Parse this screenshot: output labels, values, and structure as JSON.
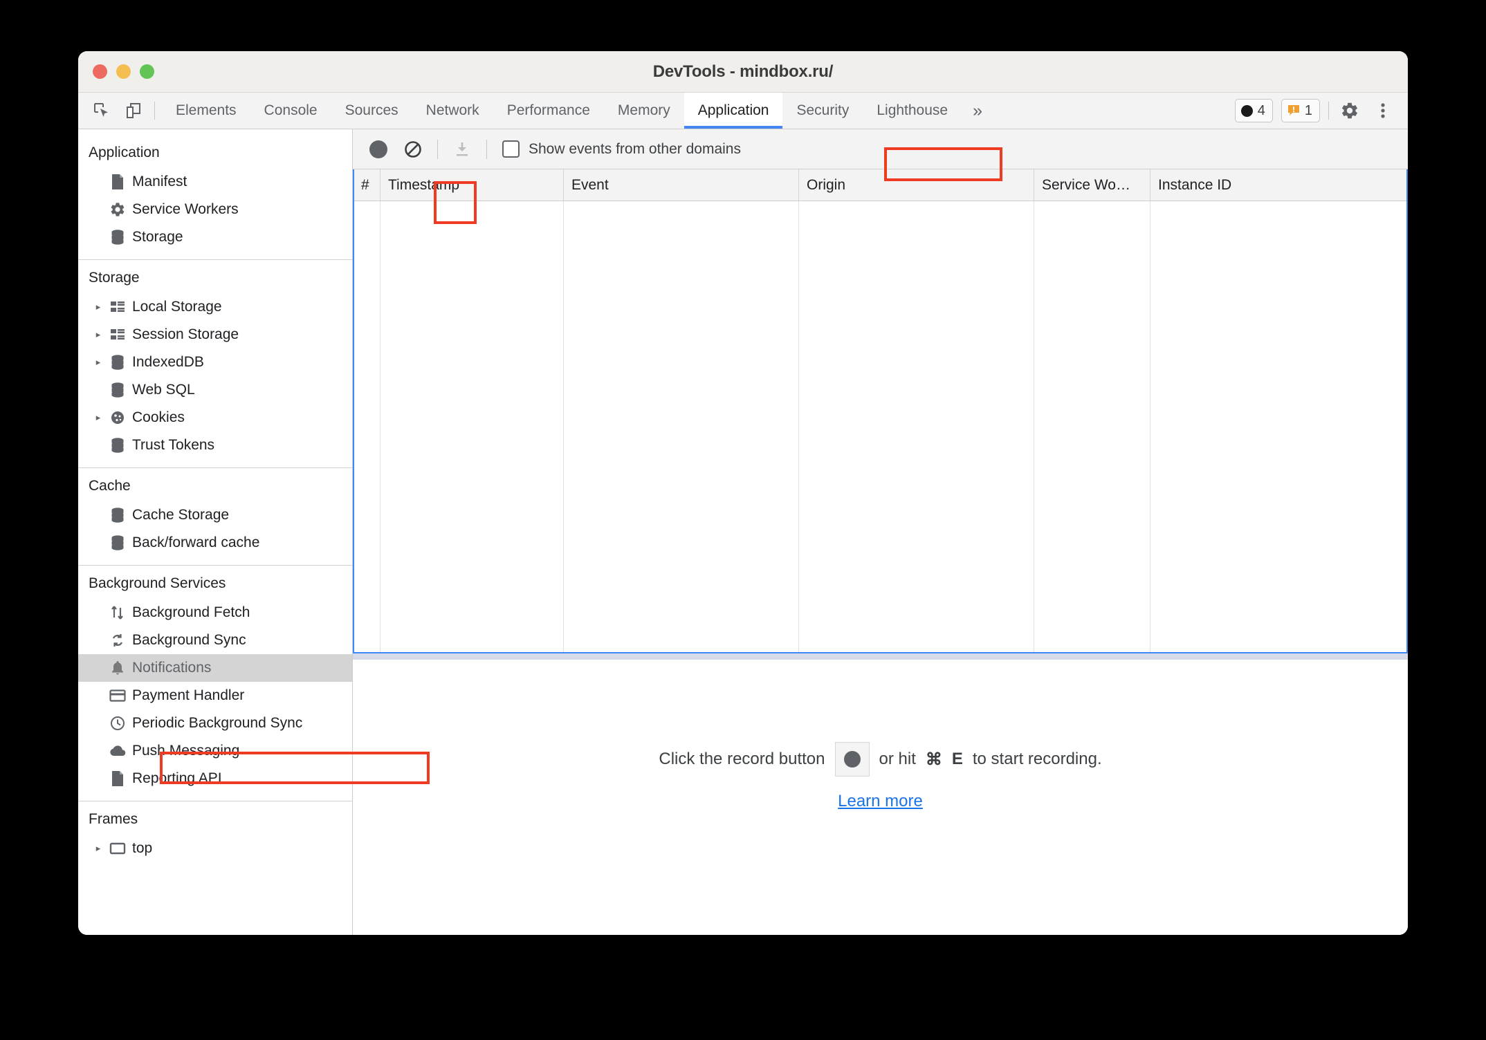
{
  "window": {
    "title": "DevTools - mindbox.ru/",
    "traffic_lights": [
      "close",
      "minimize",
      "zoom"
    ]
  },
  "tabbar": {
    "left_icons": [
      {
        "name": "inspect-element-icon"
      },
      {
        "name": "device-toolbar-icon"
      }
    ],
    "tabs": [
      {
        "label": "Elements",
        "active": false
      },
      {
        "label": "Console",
        "active": false
      },
      {
        "label": "Sources",
        "active": false
      },
      {
        "label": "Network",
        "active": false
      },
      {
        "label": "Performance",
        "active": false
      },
      {
        "label": "Memory",
        "active": false
      },
      {
        "label": "Application",
        "active": true
      },
      {
        "label": "Security",
        "active": false
      },
      {
        "label": "Lighthouse",
        "active": false
      }
    ],
    "more_tabs_label": "»",
    "error_count": "4",
    "warning_count": "1",
    "settings_icon": "gear-icon",
    "menu_icon": "kebab-menu-icon",
    "active_accent": "#4285f4"
  },
  "sidebar": {
    "sections": [
      {
        "title": "Application",
        "items": [
          {
            "label": "Manifest",
            "icon": "document-icon",
            "expandable": false,
            "selected": false
          },
          {
            "label": "Service Workers",
            "icon": "gear-icon",
            "expandable": false,
            "selected": false
          },
          {
            "label": "Storage",
            "icon": "database-icon",
            "expandable": false,
            "selected": false
          }
        ]
      },
      {
        "title": "Storage",
        "items": [
          {
            "label": "Local Storage",
            "icon": "table-icon",
            "expandable": true,
            "selected": false
          },
          {
            "label": "Session Storage",
            "icon": "table-icon",
            "expandable": true,
            "selected": false
          },
          {
            "label": "IndexedDB",
            "icon": "database-icon",
            "expandable": true,
            "selected": false
          },
          {
            "label": "Web SQL",
            "icon": "database-icon",
            "expandable": false,
            "selected": false
          },
          {
            "label": "Cookies",
            "icon": "cookie-icon",
            "expandable": true,
            "selected": false
          },
          {
            "label": "Trust Tokens",
            "icon": "database-icon",
            "expandable": false,
            "selected": false
          }
        ]
      },
      {
        "title": "Cache",
        "items": [
          {
            "label": "Cache Storage",
            "icon": "database-icon",
            "expandable": false,
            "selected": false
          },
          {
            "label": "Back/forward cache",
            "icon": "database-icon",
            "expandable": false,
            "selected": false
          }
        ]
      },
      {
        "title": "Background Services",
        "items": [
          {
            "label": "Background Fetch",
            "icon": "updown-arrows-icon",
            "expandable": false,
            "selected": false
          },
          {
            "label": "Background Sync",
            "icon": "sync-icon",
            "expandable": false,
            "selected": false
          },
          {
            "label": "Notifications",
            "icon": "bell-icon",
            "expandable": false,
            "selected": true
          },
          {
            "label": "Payment Handler",
            "icon": "credit-card-icon",
            "expandable": false,
            "selected": false
          },
          {
            "label": "Periodic Background Sync",
            "icon": "clock-icon",
            "expandable": false,
            "selected": false
          },
          {
            "label": "Push Messaging",
            "icon": "cloud-icon",
            "expandable": false,
            "selected": false
          },
          {
            "label": "Reporting API",
            "icon": "document-icon",
            "expandable": false,
            "selected": false
          }
        ]
      },
      {
        "title": "Frames",
        "items": [
          {
            "label": "top",
            "icon": "frame-icon",
            "expandable": true,
            "selected": false
          }
        ]
      }
    ]
  },
  "toolbar": {
    "record_button": "record-icon",
    "clear_button": "clear-icon",
    "export_button": "export-icon",
    "export_disabled": true,
    "checkbox_label": "Show events from other domains",
    "checkbox_checked": false
  },
  "grid": {
    "columns": [
      "#",
      "Timestamp",
      "Event",
      "Origin",
      "Service Wo…",
      "Instance ID"
    ],
    "rows": []
  },
  "empty_state": {
    "prefix": "Click the record button",
    "record_icon": "record-icon",
    "middle": "or hit",
    "shortcut_modifier": "⌘",
    "shortcut_key": "E",
    "suffix": "to start recording.",
    "learn_more": "Learn more",
    "link_color": "#1a73e8"
  },
  "annotations": {
    "color": "#ef3b24",
    "boxes": [
      "application-tab",
      "record-button",
      "notifications-sidebar-item"
    ]
  }
}
